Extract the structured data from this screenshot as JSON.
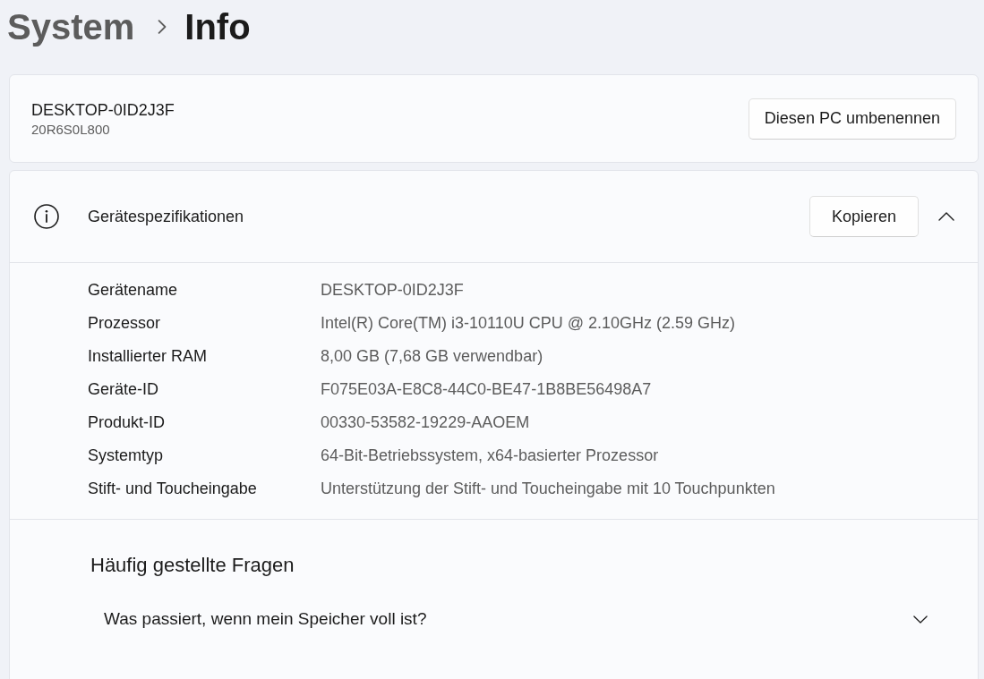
{
  "breadcrumb": [
    {
      "label": "System",
      "current": false
    },
    {
      "label": "Info",
      "current": true
    }
  ],
  "device_card": {
    "name": "DESKTOP-0ID2J3F",
    "model": "20R6S0L800",
    "button": "Diesen PC umbenennen"
  },
  "specs": {
    "title": "Gerätespezifikationen",
    "button": "Kopieren",
    "expanded": true,
    "rows": [
      {
        "label": "Gerätename",
        "value": "DESKTOP-0ID2J3F"
      },
      {
        "label": "Prozessor",
        "value": "Intel(R) Core(TM) i3-10110U CPU @ 2.10GHz (2.59 GHz)"
      },
      {
        "label": "Installierter RAM",
        "value": "8,00 GB (7,68 GB verwendbar)"
      },
      {
        "label": "Geräte-ID",
        "value": "F075E03A-E8C8-44C0-BE47-1B8BE56498A7"
      },
      {
        "label": "Produkt-ID",
        "value": "00330-53582-19229-AAOEM"
      },
      {
        "label": "Systemtyp",
        "value": "64-Bit-Betriebssystem, x64-basierter Prozessor"
      },
      {
        "label": "Stift- und Toucheingabe",
        "value": "Unterstützung der Stift- und Toucheingabe mit 10 Touchpunkten"
      }
    ]
  },
  "faq": {
    "title": "Häufig gestellte Fragen",
    "items": [
      {
        "question": "Was passiert, wenn mein Speicher voll ist?",
        "expanded": false
      }
    ]
  }
}
